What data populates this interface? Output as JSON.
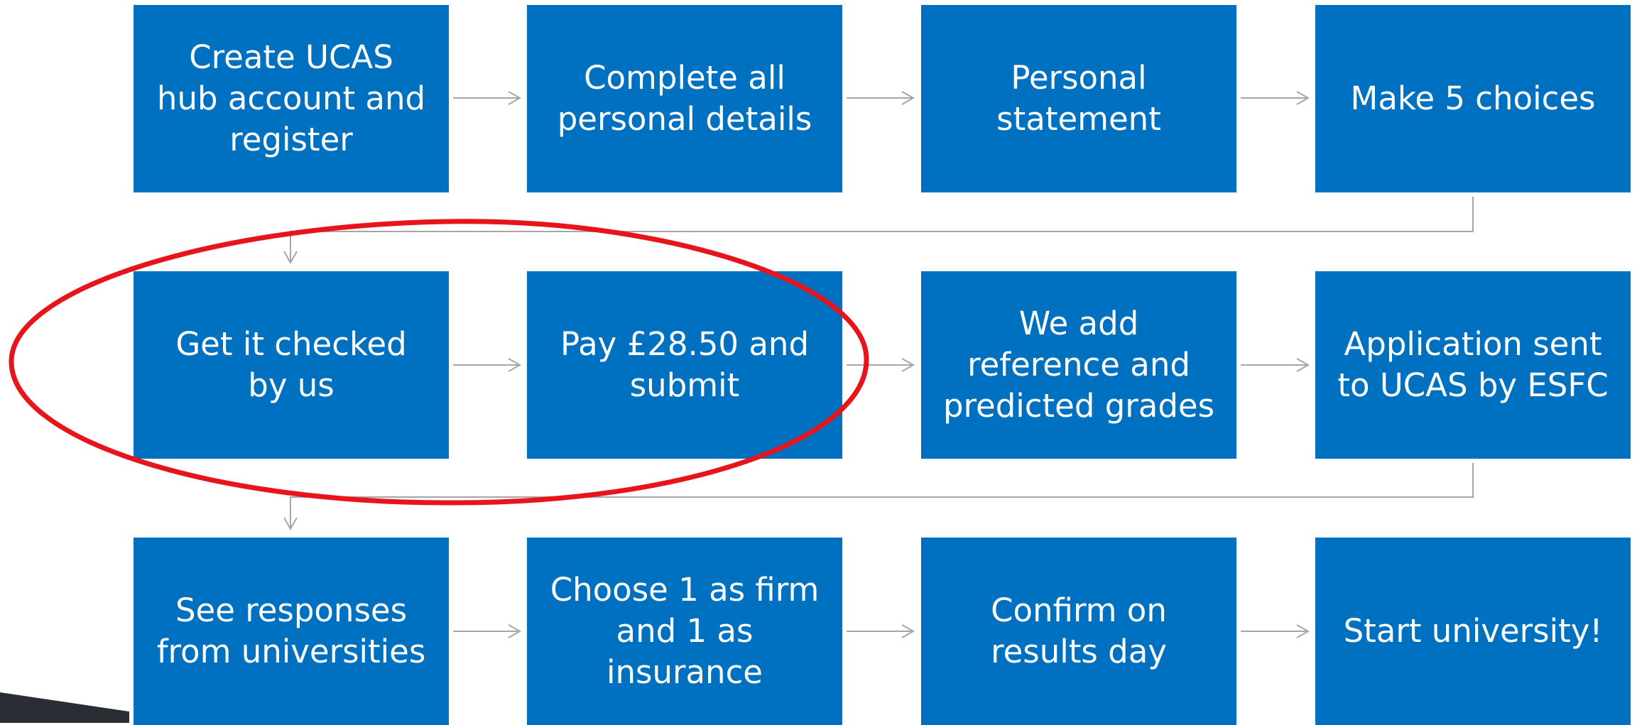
{
  "diagram": {
    "steps": [
      {
        "label": "Create UCAS\nhub account and\nregister"
      },
      {
        "label": "Complete all\npersonal details"
      },
      {
        "label": "Personal\nstatement"
      },
      {
        "label": "Make 5 choices"
      },
      {
        "label": "Get it checked\nby us"
      },
      {
        "label": "Pay £28.50 and\nsubmit"
      },
      {
        "label": "We add\nreference and\npredicted grades"
      },
      {
        "label": "Application sent\nto UCAS by ESFC"
      },
      {
        "label": "See responses\nfrom universities"
      },
      {
        "label": "Choose 1 as firm\nand 1 as\ninsurance"
      },
      {
        "label": "Confirm on\nresults day"
      },
      {
        "label": "Start university!"
      }
    ],
    "colors": {
      "box_fill": "#0070c0",
      "box_text": "#ffffff",
      "connector": "#a6a6a6",
      "highlight_ellipse": "#e8141b",
      "corner_shape": "#2b2d35"
    },
    "highlighted_steps": [
      "Get it checked\nby us",
      "Pay £28.50 and\nsubmit"
    ]
  }
}
